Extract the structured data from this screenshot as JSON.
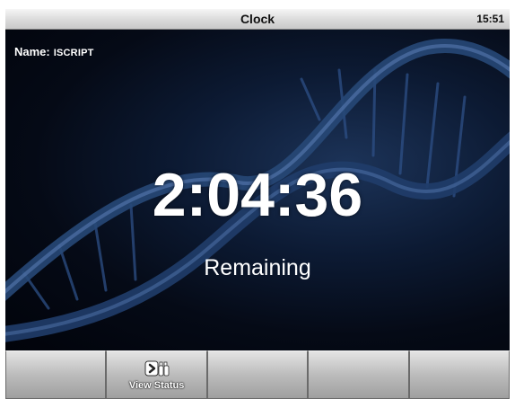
{
  "titlebar": {
    "title": "Clock",
    "time": "15:51"
  },
  "main": {
    "name_label": "Name:",
    "name_value": "ISCRIPT",
    "countdown": "2:04:36",
    "status": "Remaining"
  },
  "softkeys": [
    {
      "label": ""
    },
    {
      "label": "View Status",
      "icon": "binoculars-icon"
    },
    {
      "label": ""
    },
    {
      "label": ""
    },
    {
      "label": ""
    }
  ],
  "colors": {
    "titlebar": "#d6d6d6",
    "background": "#0c1a33",
    "text": "#ffffff",
    "softkey": "#bcbcbc"
  }
}
